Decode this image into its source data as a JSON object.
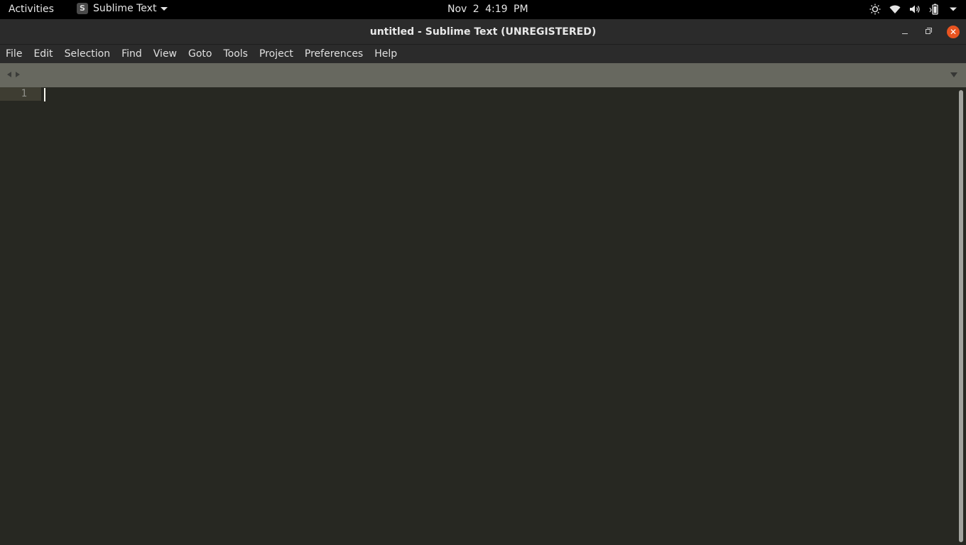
{
  "topbar": {
    "activities": "Activities",
    "app_name": "Sublime Text",
    "app_icon_letter": "S",
    "date": "Nov 2",
    "time": "4:19 PM",
    "tray_icons": [
      "brightness-icon",
      "wifi-icon",
      "volume-icon",
      "battery-icon",
      "system-menu-arrow"
    ]
  },
  "window": {
    "title": "untitled - Sublime Text (UNREGISTERED)",
    "close_color": "#e95420"
  },
  "menu": {
    "items": [
      "File",
      "Edit",
      "Selection",
      "Find",
      "View",
      "Goto",
      "Tools",
      "Project",
      "Preferences",
      "Help"
    ]
  },
  "editor": {
    "line_numbers": [
      "1"
    ],
    "background": "#272822",
    "tabbar_color": "#67685f"
  }
}
